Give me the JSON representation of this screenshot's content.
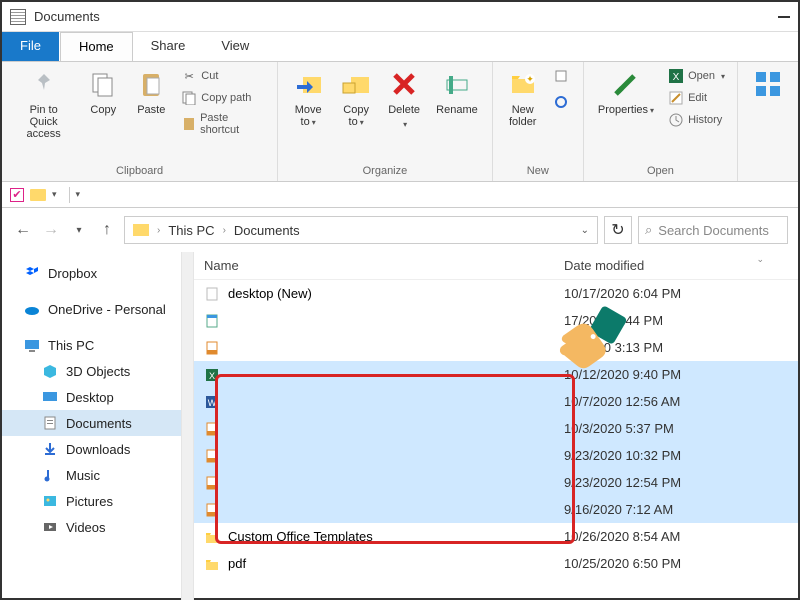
{
  "window": {
    "title": "Documents"
  },
  "menu": {
    "file": "File",
    "home": "Home",
    "share": "Share",
    "view": "View"
  },
  "ribbon": {
    "clipboard": {
      "pin": "Pin to Quick\naccess",
      "copy": "Copy",
      "paste": "Paste",
      "cut": "Cut",
      "copypath": "Copy path",
      "pasteshortcut": "Paste shortcut",
      "label": "Clipboard"
    },
    "organize": {
      "moveto": "Move\nto",
      "copyto": "Copy\nto",
      "delete": "Delete",
      "rename": "Rename",
      "label": "Organize"
    },
    "new": {
      "newfolder": "New\nfolder",
      "label": "New"
    },
    "open": {
      "properties": "Properties",
      "open": "Open",
      "edit": "Edit",
      "history": "History",
      "label": "Open"
    }
  },
  "breadcrumb": {
    "root": "This PC",
    "leaf": "Documents"
  },
  "search": {
    "placeholder": "Search Documents"
  },
  "nav": {
    "dropbox": "Dropbox",
    "onedrive": "OneDrive - Personal",
    "thispc": "This PC",
    "objects3d": "3D Objects",
    "desktop": "Desktop",
    "documents": "Documents",
    "downloads": "Downloads",
    "music": "Music",
    "pictures": "Pictures",
    "videos": "Videos"
  },
  "columns": {
    "name": "Name",
    "date": "Date modified"
  },
  "files": [
    {
      "name": "desktop (New)",
      "date": "10/17/2020 6:04 PM",
      "icon": "file",
      "sel": false
    },
    {
      "name": "",
      "date": "17/2020 2:44 PM",
      "icon": "doc",
      "sel": false
    },
    {
      "name": "",
      "date": "13/2020 3:13 PM",
      "icon": "pdf",
      "sel": false
    },
    {
      "name": "",
      "date": "10/12/2020 9:40 PM",
      "icon": "xls",
      "sel": true
    },
    {
      "name": "",
      "date": "10/7/2020 12:56 AM",
      "icon": "word",
      "sel": true
    },
    {
      "name": "",
      "date": "10/3/2020 5:37 PM",
      "icon": "pdf",
      "sel": true
    },
    {
      "name": "",
      "date": "9/23/2020 10:32 PM",
      "icon": "pdf",
      "sel": true
    },
    {
      "name": "",
      "date": "9/23/2020 12:54 PM",
      "icon": "pdf",
      "sel": true
    },
    {
      "name": "",
      "date": "9/16/2020 7:12 AM",
      "icon": "pdf",
      "sel": true
    },
    {
      "name": "Custom Office Templates",
      "date": "10/26/2020 8:54 AM",
      "icon": "folder",
      "sel": false
    },
    {
      "name": "pdf",
      "date": "10/25/2020 6:50 PM",
      "icon": "folder",
      "sel": false
    }
  ]
}
